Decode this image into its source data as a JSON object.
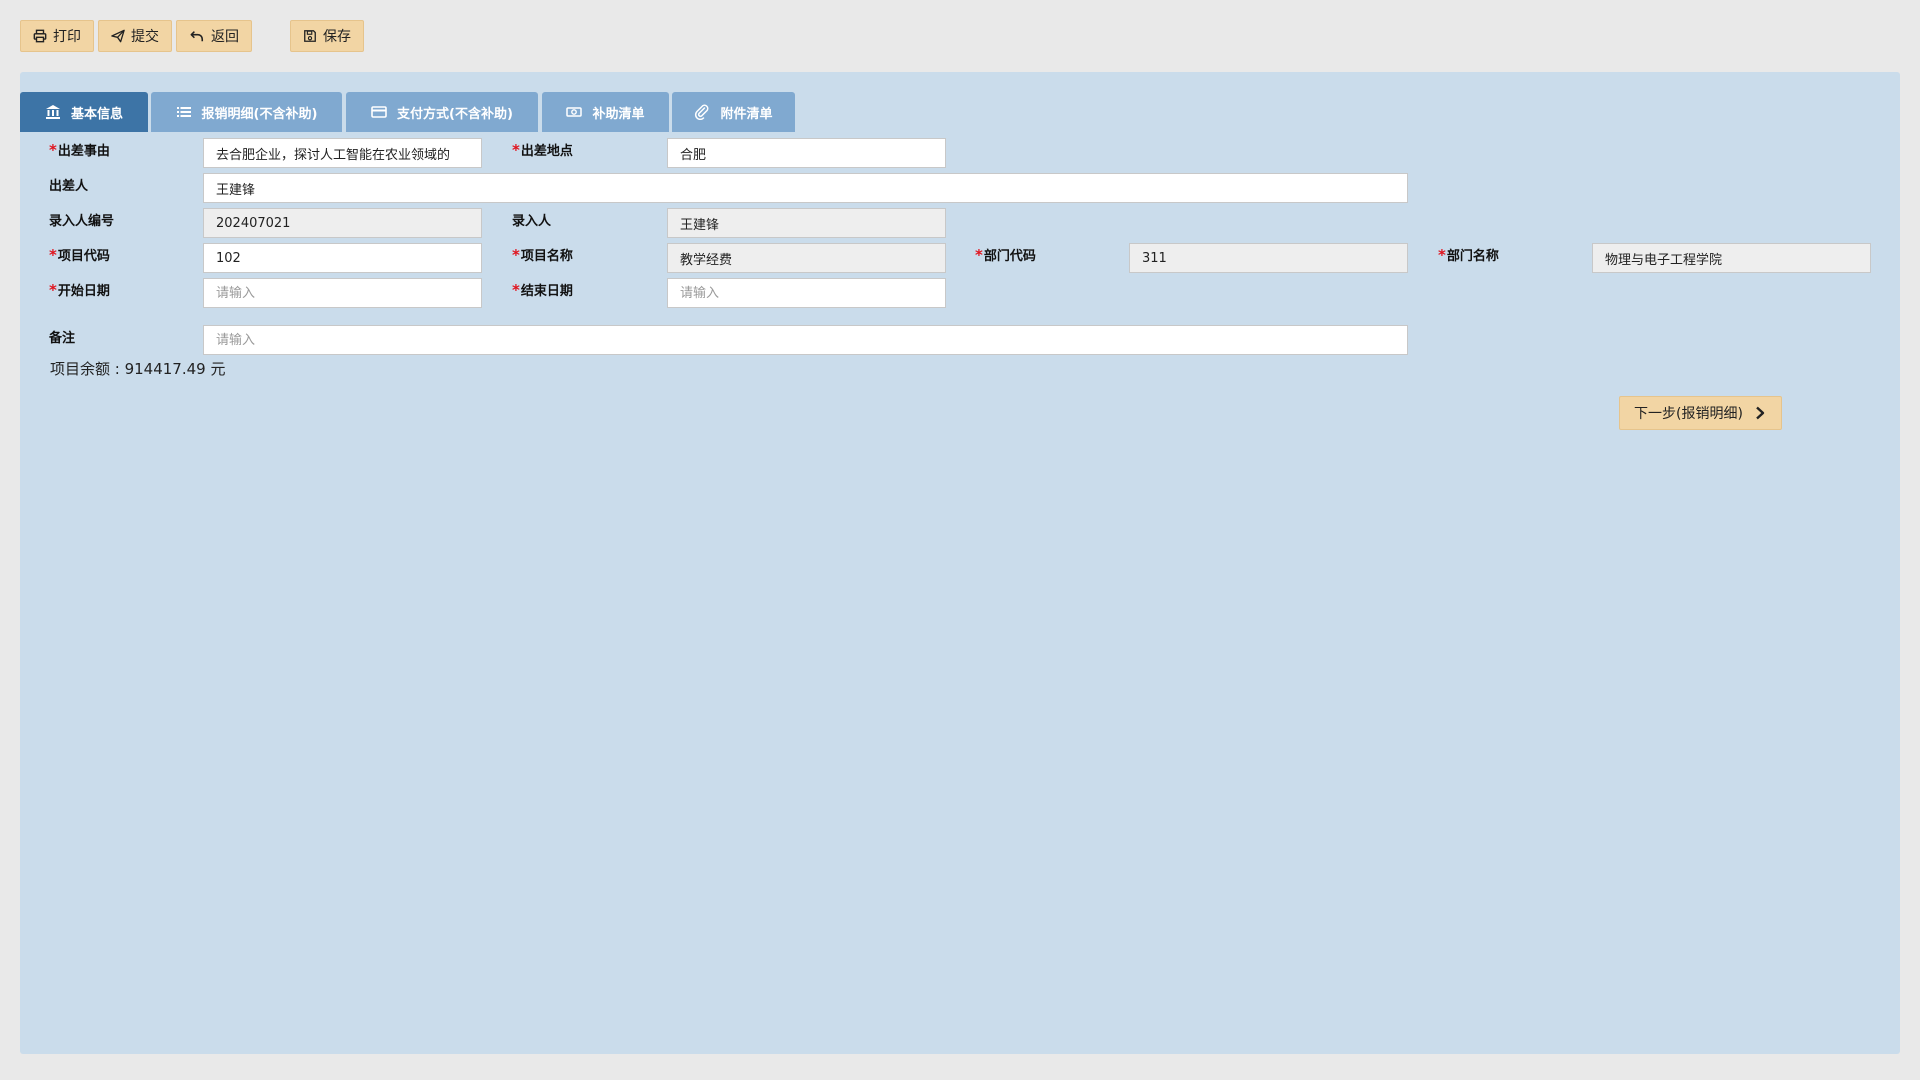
{
  "toolbar": {
    "print_label": "打印",
    "submit_label": "提交",
    "back_label": "返回",
    "save_label": "保存"
  },
  "tabs": [
    {
      "label": "基本信息",
      "icon": "bank-icon",
      "active": true
    },
    {
      "label": "报销明细(不含补助)",
      "icon": "list-icon",
      "active": false
    },
    {
      "label": "支付方式(不含补助)",
      "icon": "credit-card-icon",
      "active": false
    },
    {
      "label": "补助清单",
      "icon": "money-icon",
      "active": false
    },
    {
      "label": "附件清单",
      "icon": "paperclip-icon",
      "active": false
    }
  ],
  "form": {
    "reason": {
      "label": "出差事由",
      "value": "去合肥企业，探讨人工智能在农业领域的",
      "required": true
    },
    "location": {
      "label": "出差地点",
      "value": "合肥",
      "required": true
    },
    "traveler": {
      "label": "出差人",
      "value": "王建锋",
      "required": false
    },
    "entrant_id": {
      "label": "录入人编号",
      "value": "202407021",
      "required": false
    },
    "entrant": {
      "label": "录入人",
      "value": "王建锋",
      "required": false
    },
    "project_code": {
      "label": "项目代码",
      "value": "102",
      "required": true
    },
    "project_name": {
      "label": "项目名称",
      "value": "教学经费",
      "required": true
    },
    "dept_code": {
      "label": "部门代码",
      "value": "311",
      "required": true
    },
    "dept_name": {
      "label": "部门名称",
      "value": "物理与电子工程学院",
      "required": true
    },
    "start_date": {
      "label": "开始日期",
      "value": "",
      "placeholder": "请输入",
      "required": true
    },
    "end_date": {
      "label": "结束日期",
      "value": "",
      "placeholder": "请输入",
      "required": true
    },
    "remark": {
      "label": "备注",
      "value": "",
      "placeholder": "请输入",
      "required": false
    }
  },
  "required_mark": "*",
  "balance": {
    "text": "项目余额 : 914417.49 元"
  },
  "next_button": {
    "label": "下一步(报销明细)"
  },
  "colors": {
    "background": "#e9e9e9",
    "panel": "#cadceb",
    "tab_active": "#3d74a6",
    "tab_inactive": "#80a9d0",
    "button": "#f2d5a4",
    "required": "#e0141e"
  }
}
